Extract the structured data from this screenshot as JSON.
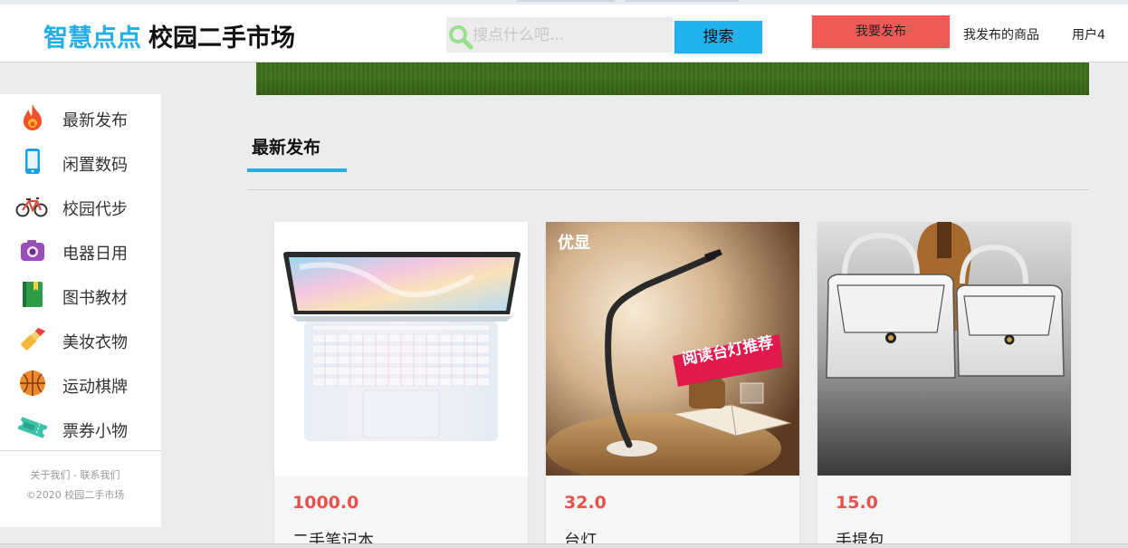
{
  "header": {
    "brand": "智慧点点",
    "subtitle": "校园二手市场",
    "search_placeholder": "搜点什么吧...",
    "search_button": "搜索",
    "publish_button": "我要发布",
    "my_items_link": "我发布的商品",
    "user_link": "用户4"
  },
  "sidebar": {
    "categories": [
      {
        "label": "最新发布",
        "icon": "fire-icon"
      },
      {
        "label": "闲置数码",
        "icon": "phone-icon"
      },
      {
        "label": "校园代步",
        "icon": "bicycle-icon"
      },
      {
        "label": "电器日用",
        "icon": "camera-icon"
      },
      {
        "label": "图书教材",
        "icon": "book-icon"
      },
      {
        "label": "美妆衣物",
        "icon": "lipstick-icon"
      },
      {
        "label": "运动棋牌",
        "icon": "basketball-icon"
      },
      {
        "label": "票券小物",
        "icon": "ticket-icon"
      }
    ],
    "footer_links": "关于我们 - 联系我们",
    "copyright": "©2020 校园二手市场"
  },
  "main": {
    "section_title": "最新发布",
    "products": [
      {
        "price": "1000.0",
        "name": "二手笔记本",
        "image": "laptop-image"
      },
      {
        "price": "32.0",
        "name": "台灯",
        "image": "desk-lamp-image",
        "image_tag": "优显",
        "image_banner": "阅读台灯推荐"
      },
      {
        "price": "15.0",
        "name": "手提包",
        "image": "handbag-image"
      }
    ]
  },
  "colors": {
    "accent": "#23aee8",
    "publish": "#ef5a57",
    "price": "#e4534c"
  }
}
